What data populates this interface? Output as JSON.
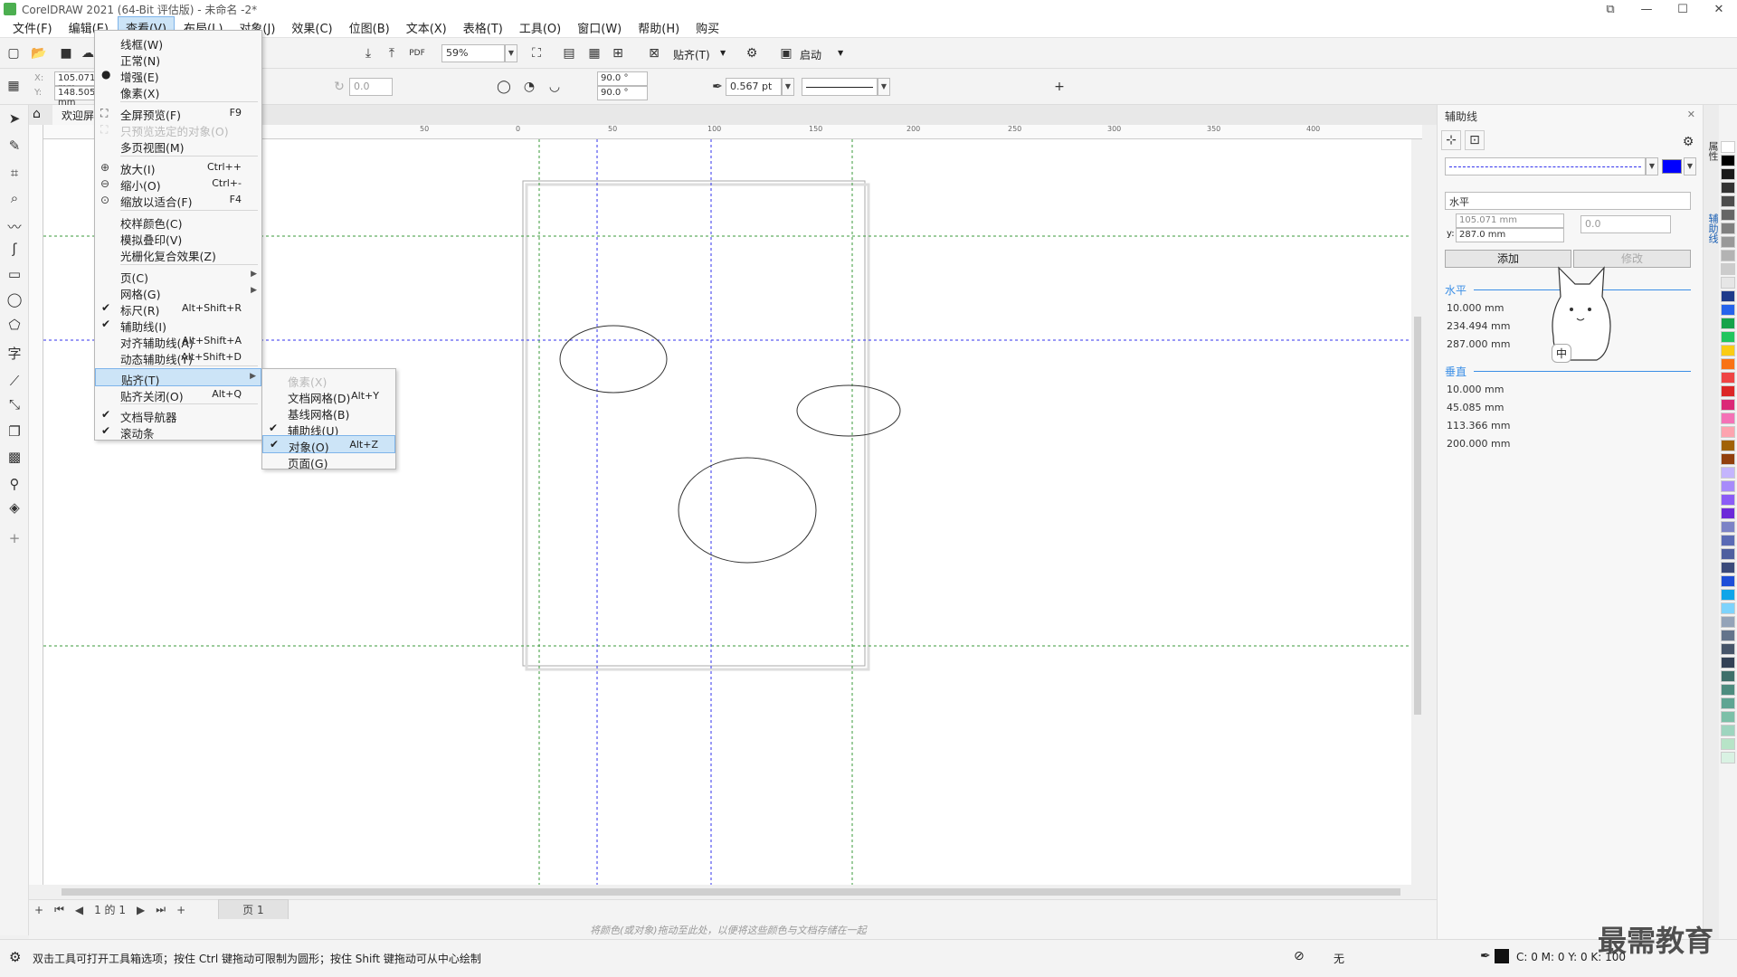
{
  "title_bar": {
    "title": "CorelDRAW 2021 (64-Bit 评估版) - 未命名 -2*",
    "min": "—",
    "max": "☐",
    "close": "✕",
    "restore": "⧉"
  },
  "menubar": [
    {
      "label": "文件(F)"
    },
    {
      "label": "编辑(E)"
    },
    {
      "label": "查看(V)"
    },
    {
      "label": "布局(L)"
    },
    {
      "label": "对象(J)"
    },
    {
      "label": "效果(C)"
    },
    {
      "label": "位图(B)"
    },
    {
      "label": "文本(X)"
    },
    {
      "label": "表格(T)"
    },
    {
      "label": "工具(O)"
    },
    {
      "label": "窗口(W)"
    },
    {
      "label": "帮助(H)"
    },
    {
      "label": "购买"
    }
  ],
  "toolbar": {
    "zoom": "59%",
    "snap_label": "贴齐(T)",
    "launch_label": "启动"
  },
  "propbar": {
    "x": "105.071 mm",
    "y": "148.505 mm",
    "x_label": "X:",
    "y_label": "Y:",
    "rotate": "0.0",
    "angle1": "90.0 °",
    "angle2": "90.0 °",
    "outline": "0.567 pt"
  },
  "doc_tab": {
    "label": "欢迎屏幕"
  },
  "view_menu": {
    "items": [
      {
        "label": "线框(W)"
      },
      {
        "label": "正常(N)"
      },
      {
        "label": "增强(E)",
        "mark": "●"
      },
      {
        "label": "像素(X)"
      },
      {
        "label": "全屏预览(F)",
        "shortcut": "F9"
      },
      {
        "label": "只预览选定的对象(O)"
      },
      {
        "label": "多页视图(M)"
      },
      {
        "label": "放大(I)",
        "shortcut": "Ctrl++"
      },
      {
        "label": "缩小(O)",
        "shortcut": "Ctrl+-"
      },
      {
        "label": "缩放以适合(F)",
        "shortcut": "F4"
      },
      {
        "label": "校样颜色(C)"
      },
      {
        "label": "模拟叠印(V)"
      },
      {
        "label": "光栅化复合效果(Z)"
      },
      {
        "label": "页(C)"
      },
      {
        "label": "网格(G)"
      },
      {
        "label": "标尺(R)",
        "shortcut": "Alt+Shift+R",
        "mark": "✔"
      },
      {
        "label": "辅助线(I)",
        "mark": "✔"
      },
      {
        "label": "对齐辅助线(A)",
        "shortcut": "Alt+Shift+A"
      },
      {
        "label": "动态辅助线(Y)",
        "shortcut": "Alt+Shift+D"
      },
      {
        "label": "贴齐(T)"
      },
      {
        "label": "贴齐关闭(O)",
        "shortcut": "Alt+Q"
      },
      {
        "label": "文档导航器",
        "mark": "✔"
      },
      {
        "label": "滚动条",
        "mark": "✔"
      }
    ]
  },
  "snap_menu": {
    "items": [
      {
        "label": "像素(X)"
      },
      {
        "label": "文档网格(D)",
        "shortcut": "Alt+Y"
      },
      {
        "label": "基线网格(B)"
      },
      {
        "label": "辅助线(U)",
        "mark": "✔"
      },
      {
        "label": "对象(O)",
        "shortcut": "Alt+Z",
        "mark": "✔"
      },
      {
        "label": "页面(G)"
      }
    ]
  },
  "docker": {
    "title": "辅助线",
    "orientation": "水平",
    "x_value": "105.071 mm",
    "y_label": "y:",
    "y_value": "287.0 mm",
    "angle": "0.0",
    "add_button": "添加",
    "modify_button": "修改",
    "horizontal_label": "水平",
    "horizontal_values": [
      "10.000 mm",
      "234.494 mm",
      "287.000 mm"
    ],
    "vertical_label": "垂直",
    "vertical_values": [
      "10.000 mm",
      "45.085 mm",
      "113.366 mm",
      "200.000 mm"
    ],
    "guide_color": "#0000ff",
    "ime_label": "中"
  },
  "side_tabs": [
    "属性",
    "辅助线"
  ],
  "page_nav": {
    "page_info": "1 的 1",
    "page_tab": "页 1"
  },
  "color_row": {
    "hint": "将颜色(或对象)拖动至此处，以便将这些颜色与文档存储在一起"
  },
  "status": {
    "hint": "双击工具可打开工具箱选项；按住 Ctrl 键拖动可限制为圆形；按住 Shift 键拖动可从中心绘制",
    "fill_none": "无",
    "cmyk": "C: 0 M: 0 Y: 0 K: 100"
  },
  "ruler": {
    "h": [
      "50",
      "0",
      "50",
      "100",
      "150",
      "200",
      "250",
      "300",
      "350",
      "400"
    ]
  },
  "watermark": "最需教育",
  "palette": [
    "#ffffff",
    "#000000",
    "#1a1a1a",
    "#333333",
    "#4d4d4d",
    "#666666",
    "#808080",
    "#999999",
    "#b3b3b3",
    "#cccccc",
    "#e6e6e6",
    "#1e3a8a",
    "#2563eb",
    "#16a34a",
    "#22c55e",
    "#facc15",
    "#f97316",
    "#ef4444",
    "#dc2626",
    "#db2777",
    "#f472b6",
    "#fda4af",
    "#a16207",
    "#92400e",
    "#c4b5fd",
    "#a78bfa",
    "#8b5cf6",
    "#6d28d9",
    "#7c83c6",
    "#5b6bb5",
    "#4f5f9f",
    "#3b4a7a",
    "#1d4ed8",
    "#0ea5e9",
    "#7dd3fc",
    "#94a3b8",
    "#64748b",
    "#475569",
    "#334155",
    "#3f6f6a",
    "#4d8c7f",
    "#5fa593",
    "#7cc0a8",
    "#9ed5bf",
    "#b7e4c7",
    "#d9f2e3"
  ]
}
